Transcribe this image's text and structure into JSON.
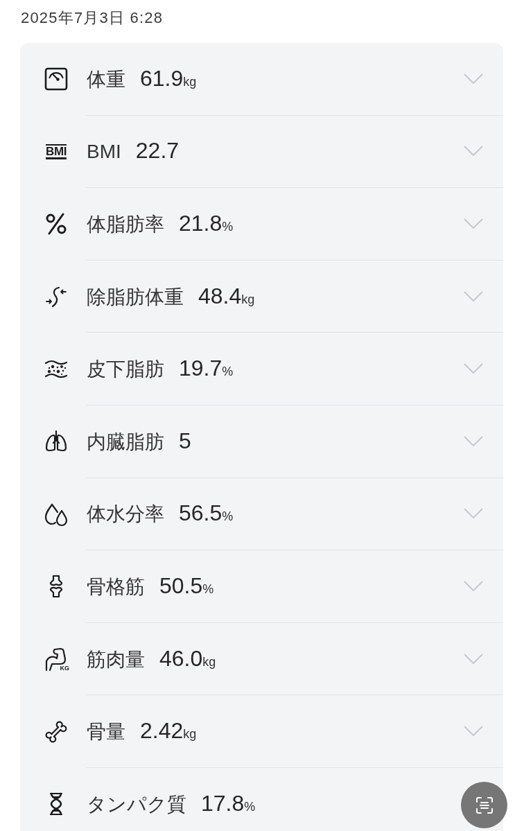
{
  "date": "2025年7月3日 6:28",
  "metrics": [
    {
      "label": "体重",
      "value": "61.9",
      "unit": "kg",
      "expanded": false
    },
    {
      "label": "BMI",
      "value": "22.7",
      "icon_text": "BMI",
      "expanded": false
    },
    {
      "label": "体脂肪率",
      "value": "21.8",
      "unit": "%",
      "expanded": false
    },
    {
      "label": "除脂肪体重",
      "value": "48.4",
      "unit": "kg",
      "expanded": false
    },
    {
      "label": "皮下脂肪",
      "value": "19.7",
      "unit": "%",
      "expanded": false
    },
    {
      "label": "内臓脂肪",
      "value": "5",
      "expanded": false
    },
    {
      "label": "体水分率",
      "value": "56.5",
      "unit": "%",
      "expanded": false
    },
    {
      "label": "骨格筋",
      "value": "50.5",
      "unit": "%",
      "expanded": false
    },
    {
      "label": "筋肉量",
      "value": "46.0",
      "unit": "kg",
      "icon_text": "KG",
      "expanded": false
    },
    {
      "label": "骨量",
      "value": "2.42",
      "unit": "kg",
      "expanded": false
    },
    {
      "label": "タンパク質",
      "value": "17.8",
      "unit": "%"
    }
  ]
}
